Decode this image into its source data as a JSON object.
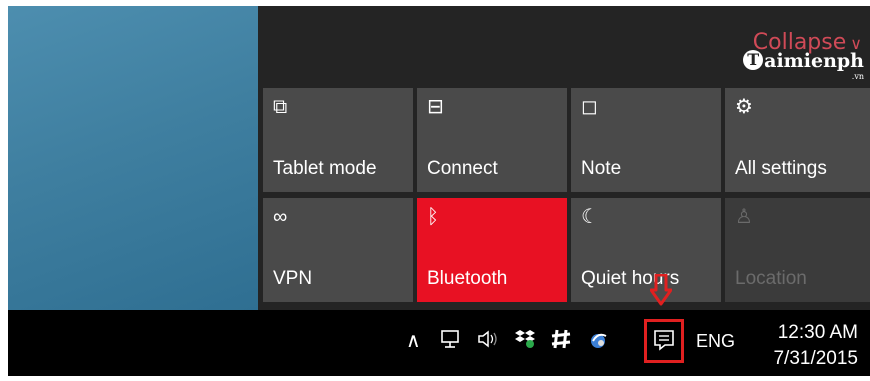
{
  "action_center": {
    "collapse_label": "Collapse",
    "watermark": "aimienph",
    "watermark_suffix": ".vn",
    "accent": "#e81123",
    "tiles": [
      {
        "label": "Tablet mode",
        "icon": "tablet-mode-icon",
        "glyph": "⧉",
        "state": "off"
      },
      {
        "label": "Connect",
        "icon": "connect-icon",
        "glyph": "⊟",
        "state": "off"
      },
      {
        "label": "Note",
        "icon": "note-icon",
        "glyph": "◻",
        "state": "off"
      },
      {
        "label": "All settings",
        "icon": "gear-icon",
        "glyph": "⚙",
        "state": "off"
      },
      {
        "label": "VPN",
        "icon": "vpn-icon",
        "glyph": "∞",
        "state": "off"
      },
      {
        "label": "Bluetooth",
        "icon": "bluetooth-icon",
        "glyph": "ᛒ",
        "state": "on"
      },
      {
        "label": "Quiet hours",
        "icon": "moon-icon",
        "glyph": "☾",
        "state": "off"
      },
      {
        "label": "Location",
        "icon": "location-icon",
        "glyph": "♙",
        "state": "disabled"
      }
    ]
  },
  "taskbar": {
    "tray_icons": [
      "chevron-up-icon",
      "network-icon",
      "volume-icon",
      "dropbox-icon",
      "slack-icon",
      "app-icon",
      "action-center-icon"
    ],
    "language": "ENG",
    "time": "12:30 AM",
    "date": "7/31/2015",
    "highlight_color": "#e02020"
  }
}
